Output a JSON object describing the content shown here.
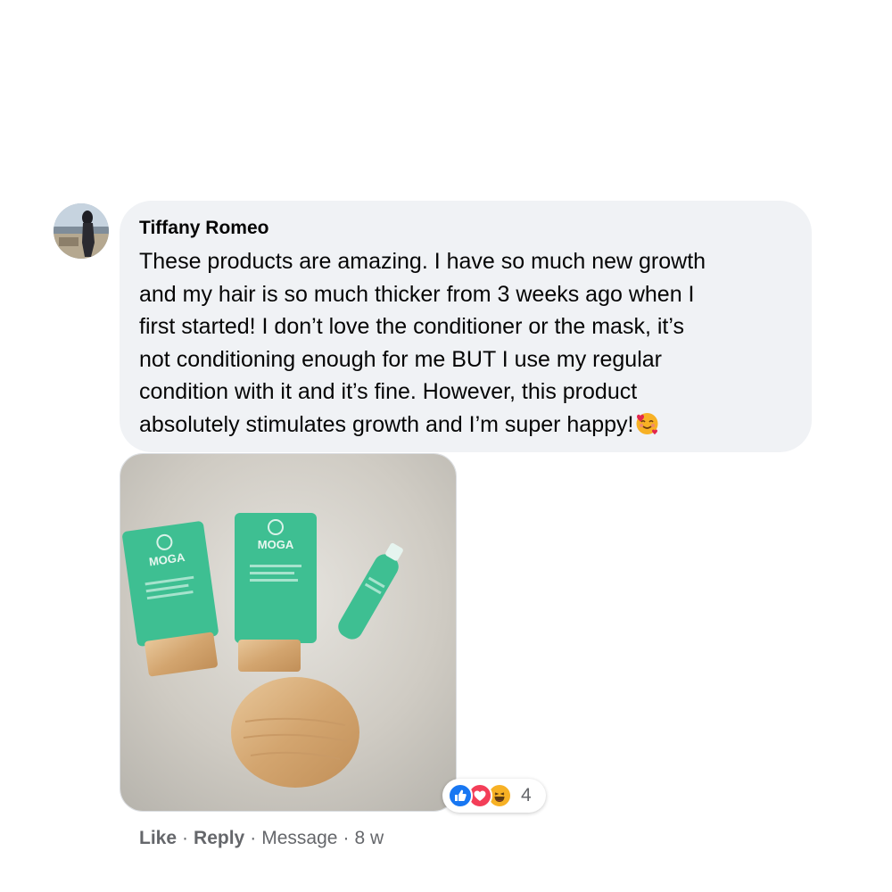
{
  "comment": {
    "author": "Tiffany Romeo",
    "text": "These products are amazing. I have so much new growth\nand my hair is so much thicker from 3 weeks ago when I\nfirst started! I don’t love the conditioner or the mask, it’s\nnot conditioning enough for me BUT I use my regular\ncondition with it and it’s fine. However, this product\nabsolutely stimulates growth and I’m super happy!",
    "emoji": "smiling-face-with-hearts-icon",
    "photo": {
      "brand_text": "MOGA"
    },
    "reactions": {
      "icons": [
        "like-icon",
        "love-icon",
        "haha-icon"
      ],
      "count": "4"
    },
    "actions": {
      "like": "Like",
      "reply": "Reply",
      "message": "Message",
      "separator": "·",
      "time": "8 w"
    }
  },
  "colors": {
    "bubble": "#f0f2f5",
    "meta_text": "#65676b",
    "like_blue": "#1877f2",
    "love_red": "#f33e58",
    "haha_yellow": "#f7b125"
  }
}
